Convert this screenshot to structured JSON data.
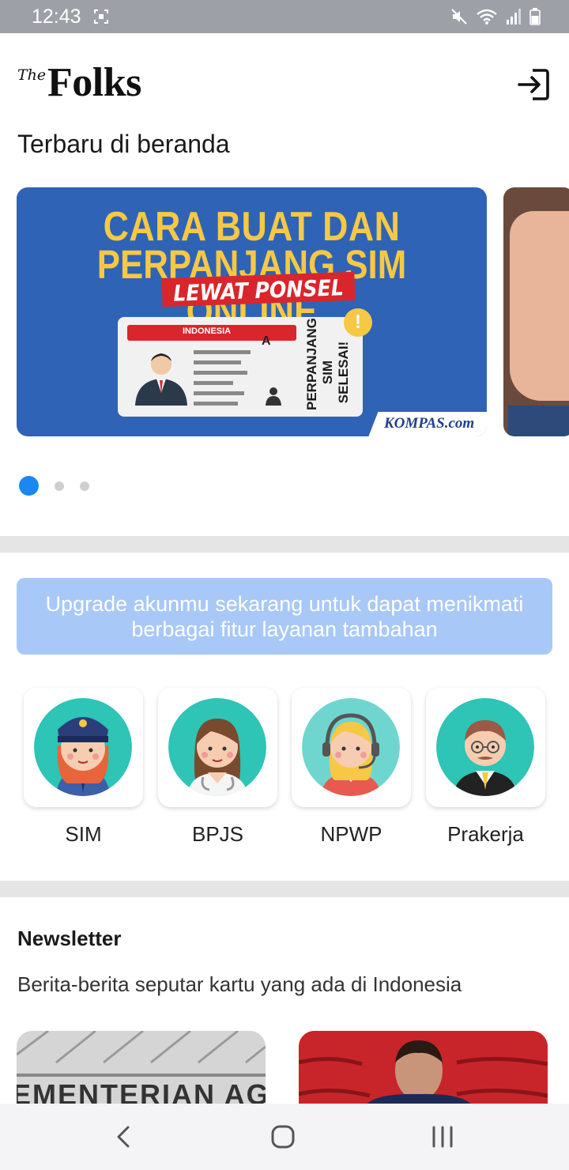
{
  "status_bar": {
    "time": "12:43",
    "icons": [
      "screenshot-icon",
      "mute-icon",
      "wifi-icon",
      "signal-icon",
      "battery-icon"
    ]
  },
  "header": {
    "logo_prefix": "The",
    "logo_main": "Folks",
    "login_icon": "login-icon"
  },
  "home": {
    "section_title": "Terbaru di beranda"
  },
  "carousel": {
    "slides": [
      {
        "headline_line1": "CARA BUAT DAN",
        "headline_line2": "PERPANJANG SIM ONLINE",
        "ribbon": "LEWAT PONSEL",
        "card_header": "INDONESIA",
        "card_class": "A",
        "side_text": "PERPANJANG SIM SELESAI!",
        "badge": "!",
        "source": "KOMPAS.com"
      }
    ],
    "slide_count": 3,
    "active_index": 0
  },
  "upgrade_banner": {
    "text": "Upgrade akunmu sekarang untuk dapat menikmati berbagai fitur layanan tambahan"
  },
  "services": [
    {
      "label": "SIM"
    },
    {
      "label": "BPJS"
    },
    {
      "label": "NPWP"
    },
    {
      "label": "Prakerja"
    }
  ],
  "newsletter": {
    "title": "Newsletter",
    "subtitle": "Berita-berita seputar kartu yang ada di Indonesia",
    "card1_visible_text": "EMENTERIAN AG"
  },
  "colors": {
    "accent": "#1a88f0",
    "banner_blue": "#2f63b6",
    "banner_yellow": "#f6c844",
    "upgrade_bg": "#a8c8f7",
    "avatar_teal": "#2ec4b6"
  }
}
